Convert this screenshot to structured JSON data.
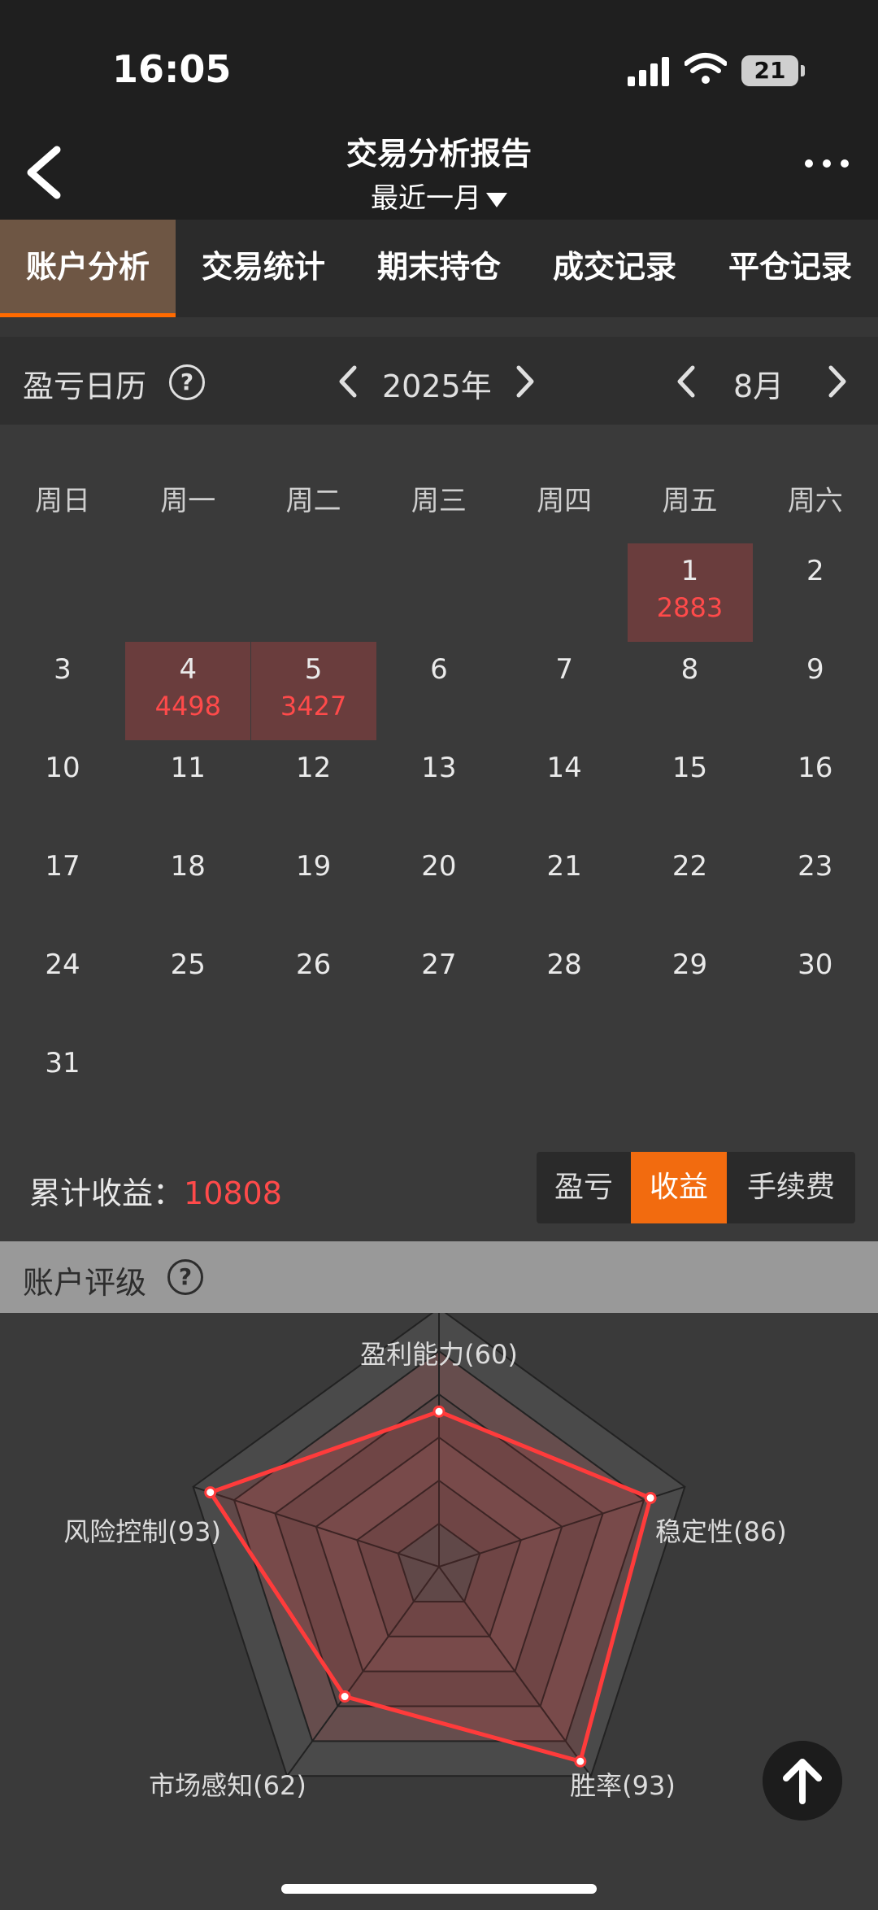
{
  "status": {
    "time": "16:05",
    "battery": "21"
  },
  "header": {
    "title": "交易分析报告",
    "period": "最近一月"
  },
  "tabs": [
    "账户分析",
    "交易统计",
    "期末持仓",
    "成交记录",
    "平仓记录"
  ],
  "active_tab": 0,
  "calendar": {
    "label": "盈亏日历",
    "year": "2025年",
    "month": "8月",
    "weekdays": [
      "周日",
      "周一",
      "周二",
      "周三",
      "周四",
      "周五",
      "周六"
    ],
    "first_weekday": 5,
    "days_in_month": 31,
    "pnl": {
      "1": "2883",
      "4": "4498",
      "5": "3427"
    }
  },
  "summary": {
    "label": "累计收益：",
    "value": "10808"
  },
  "toggle": {
    "options": [
      "盈亏",
      "收益",
      "手续费"
    ],
    "selected": 1
  },
  "rating": {
    "label": "账户评级",
    "axes": [
      {
        "label": "盈利能力(60)",
        "value": 60
      },
      {
        "label": "稳定性(86)",
        "value": 86
      },
      {
        "label": "胜率(93)",
        "value": 93
      },
      {
        "label": "市场感知(62)",
        "value": 62
      },
      {
        "label": "风险控制(93)",
        "value": 93
      }
    ],
    "max": 100
  },
  "colors": {
    "accent": "#f26b0f",
    "profit": "#ff4a4a",
    "highlight": "#6a3d3d"
  }
}
